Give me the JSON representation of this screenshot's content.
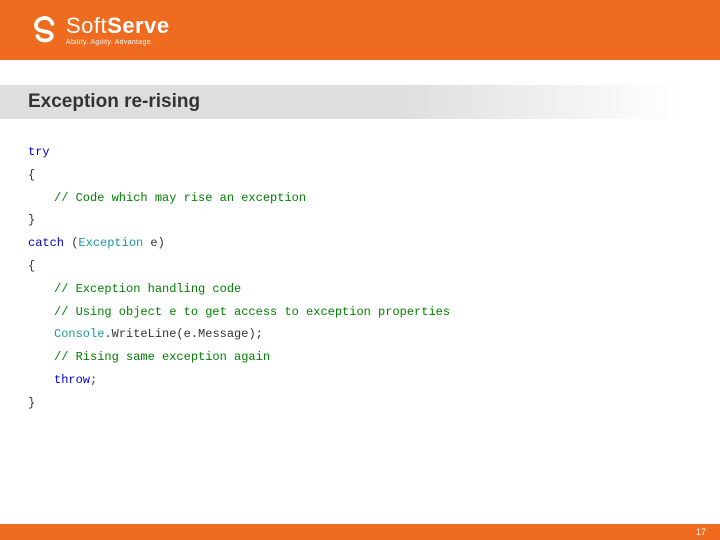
{
  "brand": {
    "name_light": "Soft",
    "name_bold": "Serve",
    "tagline": "Ability. Agility. Advantage."
  },
  "title": "Exception re-rising",
  "code": {
    "l1_kw": "try",
    "l2": "{",
    "l3_cmt": "// Code which may rise an exception",
    "l4": "}",
    "l5_kw": "catch",
    "l5_paren_open": " (",
    "l5_type": "Exception",
    "l5_rest": " e)",
    "l6": "{",
    "l7_cmt": "// Exception handling code",
    "l8_cmt": "// Using object e to get access to exception properties",
    "l9_type": "Console",
    "l9_rest": ".WriteLine(e.Message);",
    "l10_cmt": "// Rising same exception again",
    "l11_kw": "throw",
    "l11_rest": ";",
    "l12": "}"
  },
  "page_number": "17"
}
